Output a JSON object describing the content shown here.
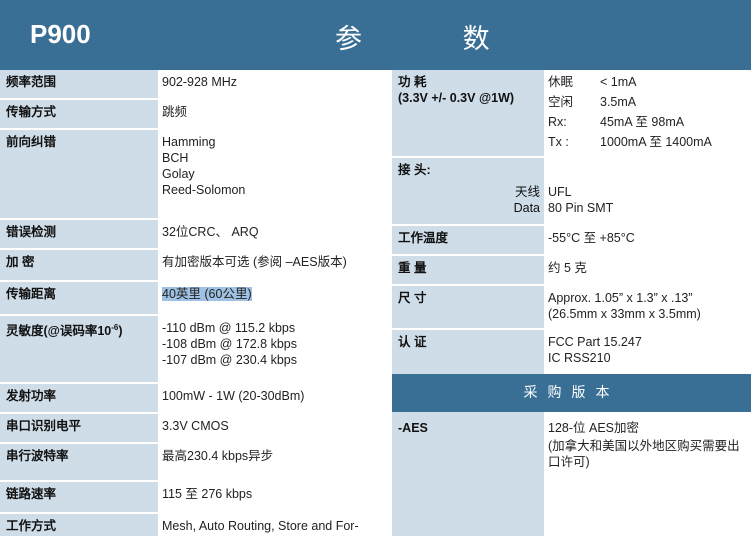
{
  "header": {
    "model": "P900",
    "title": "参 数"
  },
  "left_rows": [
    {
      "label": "频率范围",
      "lines": [
        "902-928 MHz"
      ]
    },
    {
      "label": "传输方式",
      "lines": [
        "跳频"
      ]
    },
    {
      "label": "前向纠错",
      "lines": [
        "Hamming",
        "BCH",
        "Golay",
        "Reed-Solomon"
      ]
    },
    {
      "label": "错误检测",
      "lines": [
        "32位CRC、 ARQ"
      ]
    },
    {
      "label": "加 密",
      "lines": [
        "有加密版本可选 (参阅 –AES版本)"
      ]
    },
    {
      "label": "传输距离",
      "lines": [
        "40英里 (60公里)"
      ]
    },
    {
      "label": "灵敏度(@误码率10",
      "label_sup": "-6",
      "label_end": ")",
      "lines": [
        "-110 dBm @ 115.2 kbps",
        "-108 dBm @ 172.8 kbps",
        "-107 dBm @ 230.4 kbps"
      ]
    },
    {
      "label": "发射功率",
      "lines": [
        "100mW - 1W (20-30dBm)"
      ]
    },
    {
      "label": "串口识别电平",
      "lines": [
        "3.3V CMOS"
      ]
    },
    {
      "label": "串行波特率",
      "lines": [
        "最高230.4 kbps异步"
      ]
    },
    {
      "label": "链路速率",
      "lines": [
        "115 至 276 kbps"
      ]
    },
    {
      "label": "工作方式",
      "lines": [
        "Mesh, Auto Routing, Store and For-"
      ]
    }
  ],
  "power": {
    "label": "功 耗",
    "sublabel": "(3.3V +/- 0.3V @1W)",
    "items": [
      {
        "key": "休眠",
        "value": "< 1mA"
      },
      {
        "key": "空闲",
        "value": "3.5mA"
      },
      {
        "key": "Rx:",
        "value": "45mA 至 98mA"
      },
      {
        "key": "Tx :",
        "value": "1000mA 至 1400mA"
      }
    ]
  },
  "connector": {
    "label": "接 头:",
    "items": [
      {
        "key": "天线",
        "value": "UFL"
      },
      {
        "key": "Data",
        "value": "80 Pin SMT"
      }
    ]
  },
  "right_rows": [
    {
      "label": "工作温度",
      "lines": [
        "-55°C 至 +85°C"
      ]
    },
    {
      "label": "重 量",
      "lines": [
        "约 5 克"
      ]
    },
    {
      "label": "尺 寸",
      "lines": [
        "Approx. 1.05” x 1.3” x .13”",
        "(26.5mm x 33mm x 3.5mm)"
      ]
    },
    {
      "label": "认 证",
      "lines": [
        "FCC Part 15.247",
        "IC RSS210"
      ]
    }
  ],
  "purchase": {
    "section_title": "采购版本",
    "label": "-AES",
    "lines": [
      "128-位 AES加密",
      "(加拿大和美国以外地区购买需要出",
      "口许可)"
    ]
  }
}
